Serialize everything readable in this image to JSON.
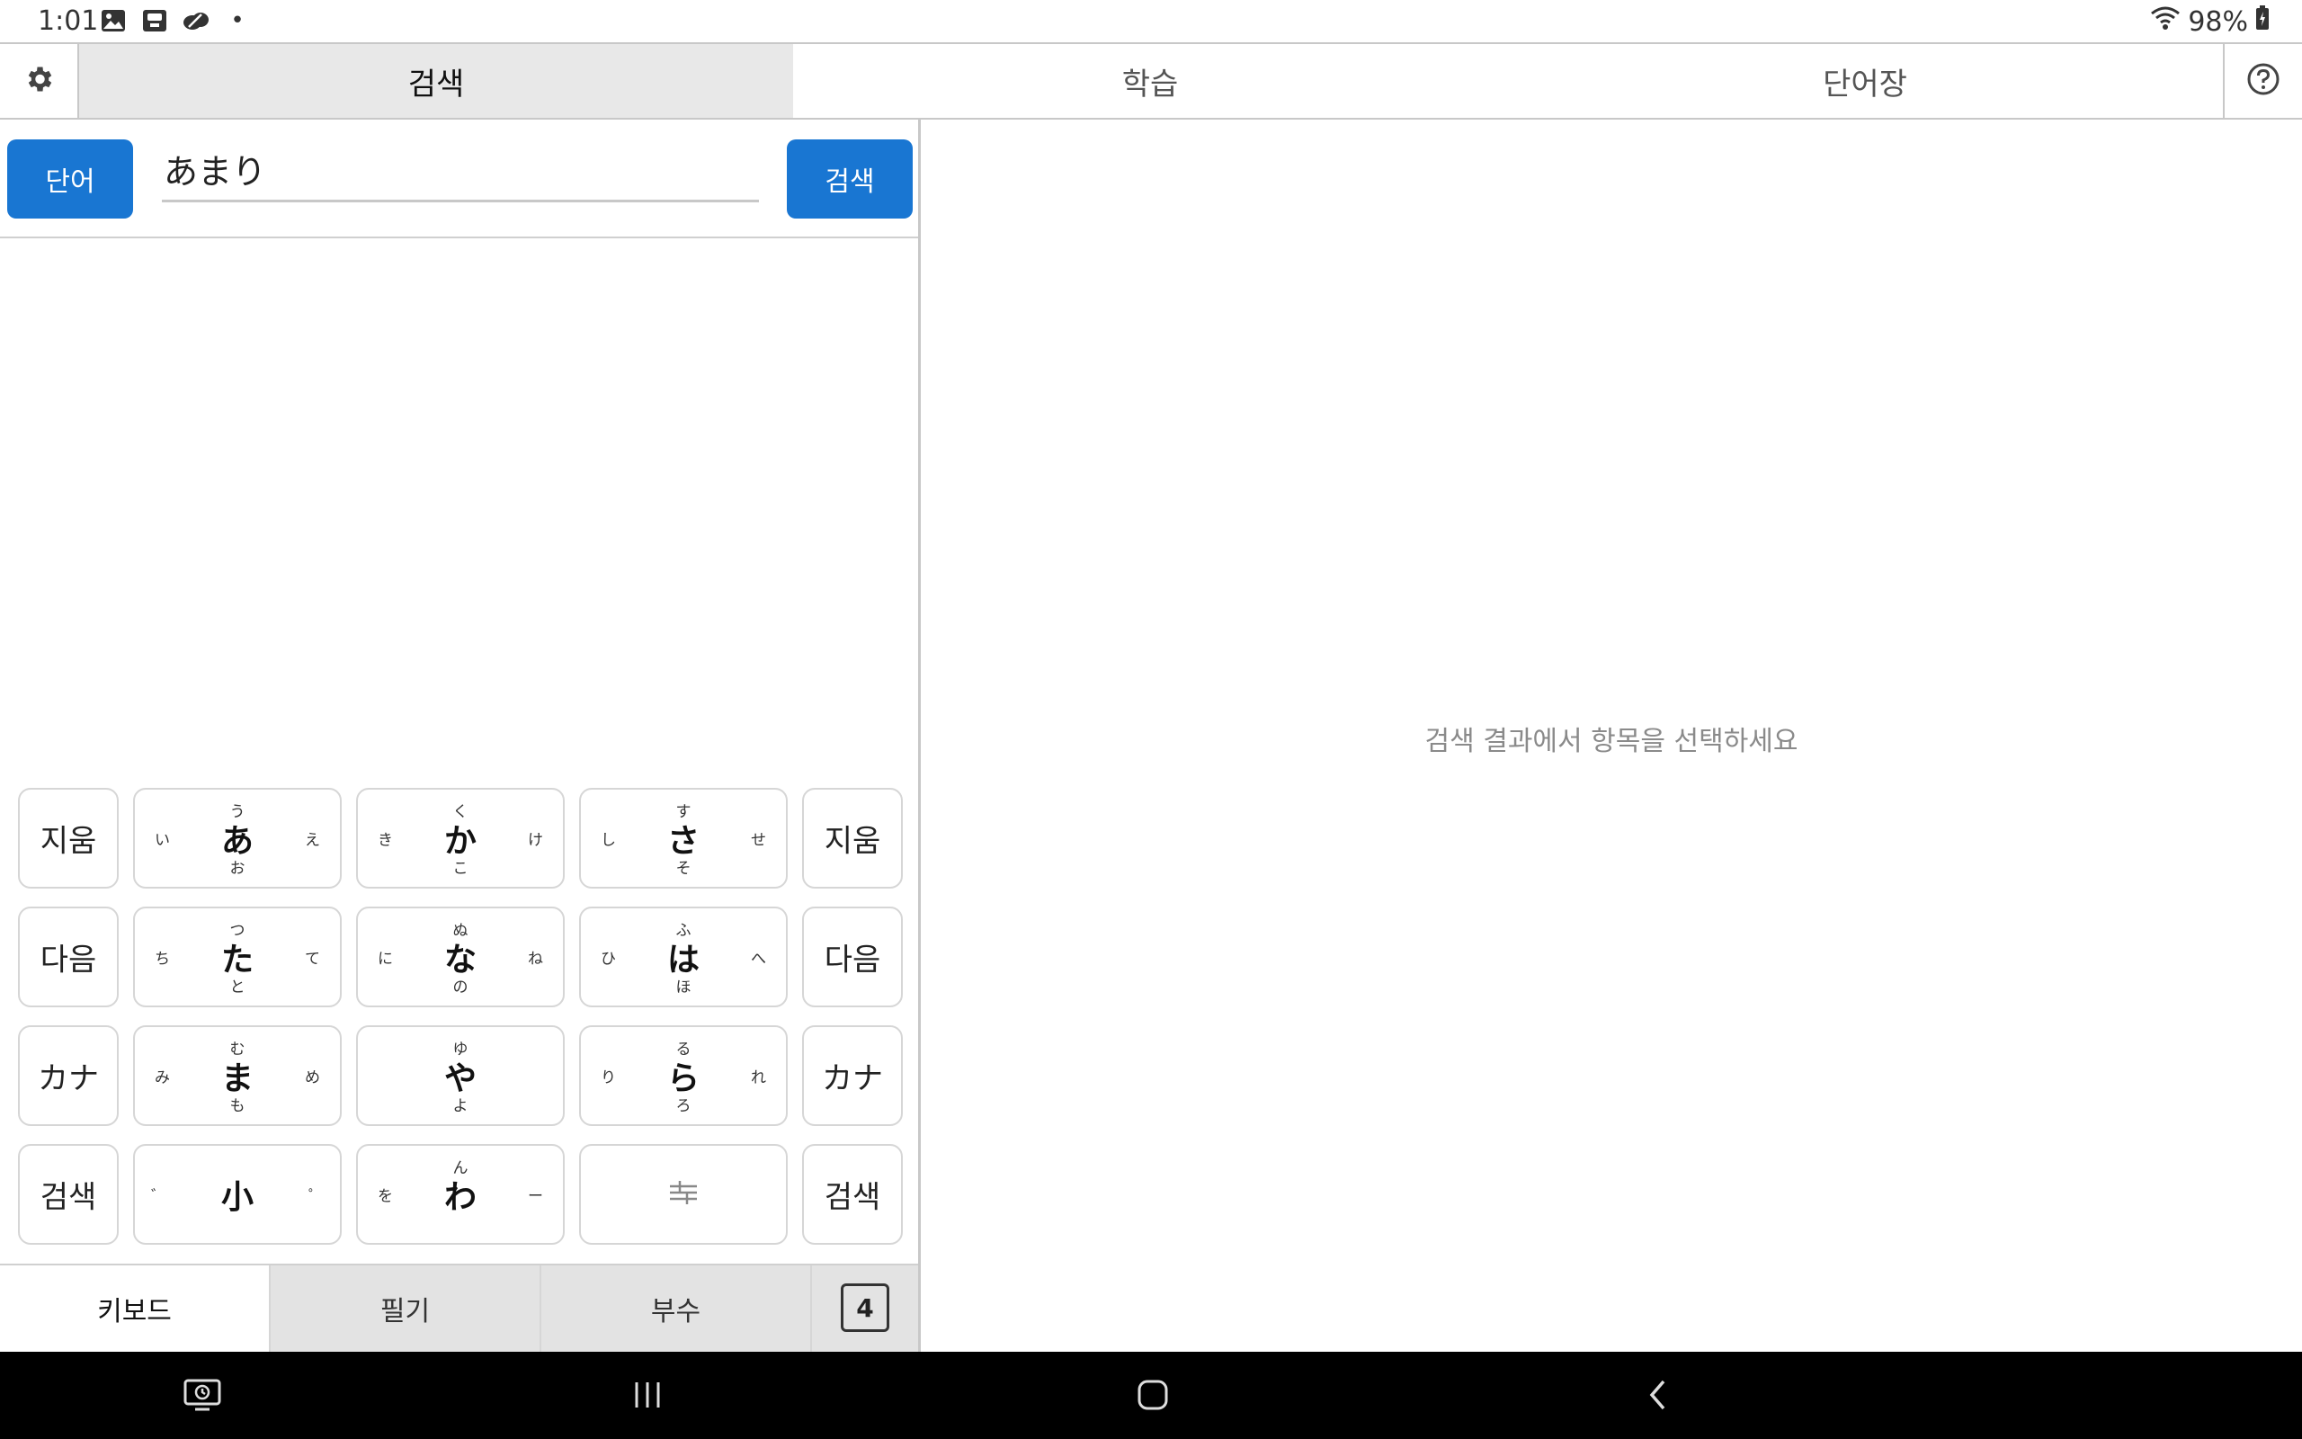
{
  "status_bar": {
    "time": "1:01",
    "dot": "•",
    "battery": "98%"
  },
  "tabs": [
    {
      "label": "검색"
    },
    {
      "label": "학습"
    },
    {
      "label": "단어장"
    }
  ],
  "search": {
    "mode_label": "단어",
    "query": "あまり",
    "button_label": "검색"
  },
  "keypad": {
    "side_left": [
      "지움",
      "다음",
      "カナ",
      "검색"
    ],
    "side_right": [
      "지움",
      "다음",
      "カナ",
      "검색"
    ],
    "keys": [
      {
        "main": "あ",
        "top": "う",
        "left": "い",
        "right": "え",
        "bottom": "お"
      },
      {
        "main": "か",
        "top": "く",
        "left": "き",
        "right": "け",
        "bottom": "こ"
      },
      {
        "main": "さ",
        "top": "す",
        "left": "し",
        "right": "せ",
        "bottom": "そ"
      },
      {
        "main": "た",
        "top": "つ",
        "left": "ち",
        "right": "て",
        "bottom": "と"
      },
      {
        "main": "な",
        "top": "ぬ",
        "left": "に",
        "right": "ね",
        "bottom": "の"
      },
      {
        "main": "は",
        "top": "ふ",
        "left": "ひ",
        "right": "へ",
        "bottom": "ほ"
      },
      {
        "main": "ま",
        "top": "む",
        "left": "み",
        "right": "め",
        "bottom": "も"
      },
      {
        "main": "や",
        "top": "ゆ",
        "left": "",
        "right": "",
        "bottom": "よ"
      },
      {
        "main": "ら",
        "top": "る",
        "left": "り",
        "right": "れ",
        "bottom": "ろ"
      },
      {
        "main": "小",
        "top": "",
        "left": "゛",
        "right": "゜",
        "bottom": ""
      },
      {
        "main": "わ",
        "top": "ん",
        "left": "を",
        "right": "ー",
        "bottom": ""
      }
    ]
  },
  "input_modes": [
    {
      "label": "키보드"
    },
    {
      "label": "필기"
    },
    {
      "label": "부수"
    }
  ],
  "mode_badge": "4",
  "detail": {
    "placeholder": "검색 결과에서 항목을 선택하세요"
  },
  "colors": {
    "accent": "#1976d2",
    "active_tab_bg": "#e8e8e8",
    "inactive_mode_bg": "#e3e3e3"
  },
  "icons": {
    "settings": "gear-icon",
    "help": "help-circle-icon",
    "tune": "tune-icon"
  }
}
